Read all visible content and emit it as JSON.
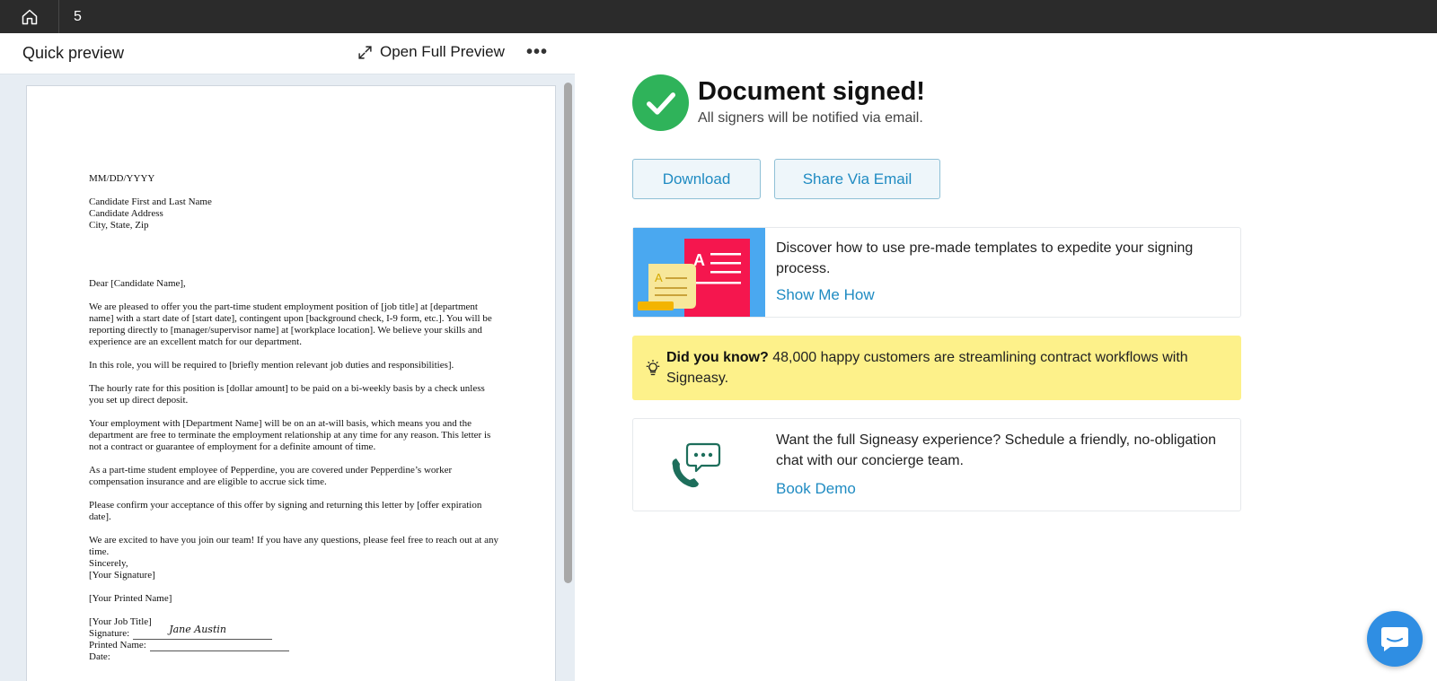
{
  "topbar": {
    "home_icon": "home-icon",
    "tab_count": "5"
  },
  "preview": {
    "title": "Quick preview",
    "open_full_label": "Open Full Preview",
    "more_label": "•••",
    "document": {
      "date": "MM/DD/YYYY",
      "address_lines": [
        "Candidate First and Last Name",
        "Candidate Address",
        "City, State, Zip"
      ],
      "salutation": "Dear [Candidate Name],",
      "paragraphs": [
        "We are pleased to offer you the part-time student employment position of [job title] at [department name] with a start date of [start date], contingent upon [background check, I-9 form, etc.]. You will be reporting directly to [manager/supervisor name] at [workplace location]. We believe your skills and experience are an excellent match for our department.",
        "In this role, you will be required to [briefly mention relevant job duties and responsibilities].",
        "The hourly rate for this position is [dollar amount] to be paid on a bi-weekly basis by a check unless you set up direct deposit.",
        "Your employment with [Department Name] will be on an at-will basis, which means you and the department are free to terminate the employment relationship at any time for any reason. This letter is not a contract or guarantee of employment for a definite amount of time.",
        "As a part-time student employee of Pepperdine, you are covered under Pepperdine’s worker compensation insurance and are eligible to accrue sick time.",
        "Please confirm your acceptance of this offer by signing and returning this letter by [offer expiration date]."
      ],
      "closing_lines": [
        "We are excited to have you join our team! If you have any questions, please feel free to reach out at any time.",
        "Sincerely,",
        "[Your Signature]"
      ],
      "printed_name": "[Your Printed Name]",
      "job_title": "[Your Job Title]",
      "signature_label": "Signature:",
      "signature_script": "Jane Austin",
      "printed_name_label": "Printed Name:",
      "date_label": "Date:"
    }
  },
  "status": {
    "title": "Document signed!",
    "subtitle": "All signers will be notified via email."
  },
  "actions": {
    "download_label": "Download",
    "share_label": "Share Via Email"
  },
  "templates_card": {
    "text": "Discover how to use pre-made templates to expedite your signing process.",
    "link": "Show Me How"
  },
  "did_you_know": {
    "heading": "Did you know?",
    "text": " 48,000 happy customers are streamlining contract workflows with Signeasy."
  },
  "demo_card": {
    "text": "Want the full Signeasy experience? Schedule a friendly, no-obligation chat with our concierge team.",
    "link": "Book Demo"
  },
  "colors": {
    "accent": "#1f8bc2",
    "success": "#2fb35a",
    "highlight": "#fdf18a",
    "topbar": "#2b2b2b",
    "chat": "#2f8ee3"
  }
}
